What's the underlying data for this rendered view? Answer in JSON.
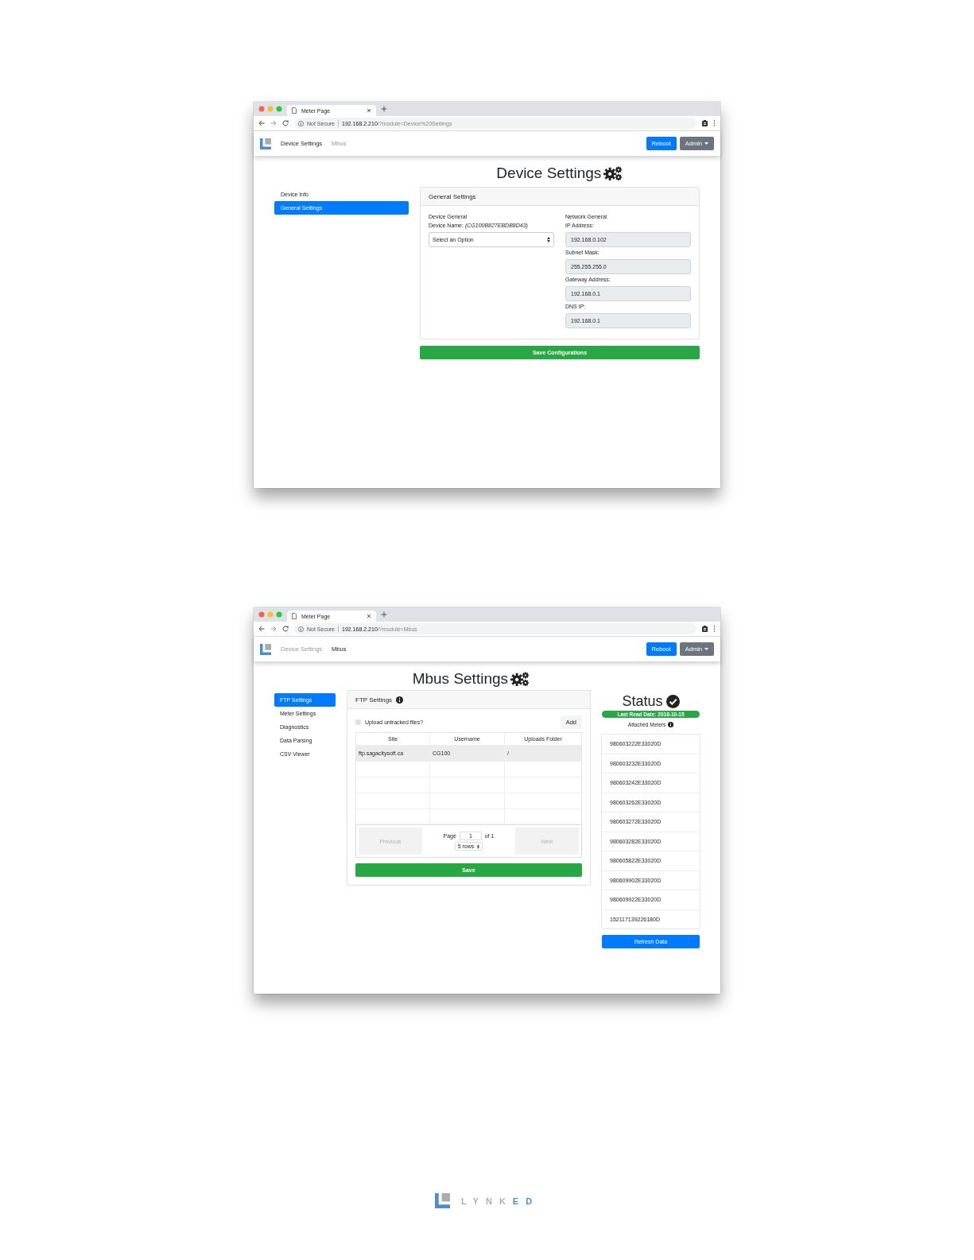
{
  "windows": [
    {
      "kind": "device_settings",
      "tab_title": "Meter Page",
      "url": {
        "security": "Not Secure",
        "host": "192.168.2.210",
        "path": "/?module=Device%20Settings"
      },
      "nav": [
        {
          "label": "Device Settings",
          "selected": true
        },
        {
          "label": "Mbus",
          "selected": false
        }
      ],
      "reboot": "Reboot",
      "admin": "Admin",
      "heading": "Device Settings",
      "sidebar": [
        {
          "label": "Device Info",
          "selected": false
        },
        {
          "label": "General Settings",
          "selected": true
        }
      ],
      "card": {
        "title": "General Settings",
        "device": {
          "title": "Device General",
          "name_label": "Device Name:",
          "name_value": "(CG100B827EBDB8D43)",
          "select": "Select an Option"
        },
        "network": {
          "title": "Network General",
          "fields": [
            {
              "label": "IP Address:",
              "value": "192.168.0.102"
            },
            {
              "label": "Subnet Mask:",
              "value": "255.255.255.0"
            },
            {
              "label": "Gateway Address:",
              "value": "192.168.0.1"
            },
            {
              "label": "DNS IP:",
              "value": "192.168.0.1"
            }
          ]
        }
      },
      "save": "Save Configurations"
    },
    {
      "kind": "mbus",
      "tab_title": "Meter Page",
      "url": {
        "security": "Not Secure",
        "host": "192.168.2.210",
        "path": "/?module=Mbus"
      },
      "nav": [
        {
          "label": "Device Settings",
          "selected": false
        },
        {
          "label": "Mbus",
          "selected": true
        }
      ],
      "reboot": "Reboot",
      "admin": "Admin",
      "heading": "Mbus Settings",
      "sidebar": [
        {
          "label": "FTP Settings",
          "selected": true
        },
        {
          "label": "Meter Settings",
          "selected": false
        },
        {
          "label": "Diagnostics",
          "selected": false
        },
        {
          "label": "Data Parsing",
          "selected": false
        },
        {
          "label": "CSV Viewer",
          "selected": false
        }
      ],
      "card": {
        "title": "FTP Settings",
        "checkbox": {
          "label": "Upload untracked files?",
          "checked": false
        },
        "add": "Add",
        "table": {
          "columns": [
            "Site",
            "Username",
            "Uploads Folder"
          ],
          "rows": [
            {
              "cells": [
                "ftp.sagacitysoft.ca",
                "CG100",
                "/"
              ],
              "selected": true
            }
          ]
        },
        "pager": {
          "previous": {
            "label": "Previous",
            "disabled": true
          },
          "page_label": "Page",
          "page": "1",
          "of": "of 1",
          "rows": "5 rows",
          "next": {
            "label": "Next",
            "disabled": true
          }
        },
        "save": "Save"
      },
      "status": {
        "title": "Status",
        "badge": "Last Read Date: 2018-10-15",
        "meters_label": "Attached Meters",
        "meters": [
          "980603222E33020D",
          "980603232E33020D",
          "980603242E33020D",
          "980603262E33020D",
          "980603272E33020D",
          "980603282E33020D",
          "980605822E33020D",
          "980609902E33020D",
          "980609922E33020D",
          "152117139226180D"
        ],
        "refresh": "Refresh Data"
      }
    }
  ],
  "brand": "LYNKED"
}
